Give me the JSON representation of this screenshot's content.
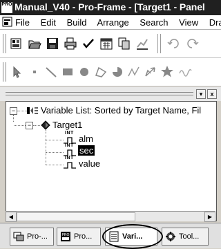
{
  "window": {
    "title": "Manual_V40 - Pro-Frame - [Target1 - Panel",
    "app_icon_text": "PRO"
  },
  "menu": {
    "items": [
      "File",
      "Edit",
      "Build",
      "Arrange",
      "Search",
      "View",
      "Dra"
    ]
  },
  "toolbar_top": {
    "icons": [
      "new-panel-icon",
      "open-folder-icon",
      "save-disk-icon",
      "print-icon",
      "check-icon",
      "calendar-icon",
      "copy-icon",
      "chart-icon",
      "undo-icon",
      "redo-icon"
    ]
  },
  "toolbar_draw": {
    "icons": [
      "pointer-icon",
      "dot-icon",
      "line-icon",
      "rectangle-icon",
      "ellipse-icon",
      "polygon-icon",
      "pie-icon",
      "polyline-icon",
      "arrow-icon",
      "star-icon",
      "freehand-icon"
    ]
  },
  "panel": {
    "collapse_button": "▾",
    "close_button": "x"
  },
  "tree": {
    "root_label": "Variable List: Sorted by Target Name, Fil",
    "target_label": "Target1",
    "type_badge": "INT",
    "variables": [
      {
        "name": "alm",
        "selected": false
      },
      {
        "name": "sec",
        "selected": true
      },
      {
        "name": "value",
        "selected": false
      }
    ]
  },
  "tabs": [
    {
      "label": "Pro-...",
      "icon": "project-icon",
      "active": false
    },
    {
      "label": "Pro...",
      "icon": "pro-frame-icon",
      "active": false
    },
    {
      "label": "Vari...",
      "icon": "variable-list-icon",
      "active": true
    },
    {
      "label": "Tool...",
      "icon": "toolbox-icon",
      "active": false
    }
  ]
}
